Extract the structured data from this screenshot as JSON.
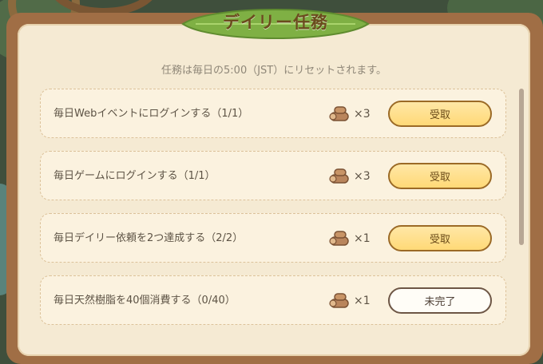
{
  "title": "デイリー任務",
  "notice": "任務は毎日の5:00（JST）にリセットされます。",
  "reward_icon": "wood-log-icon",
  "tasks": [
    {
      "label": "毎日Webイベントにログインする（1/1）",
      "reward": "×3",
      "button": "受取",
      "state": "claim"
    },
    {
      "label": "毎日ゲームにログインする（1/1）",
      "reward": "×3",
      "button": "受取",
      "state": "claim"
    },
    {
      "label": "毎日デイリー依頼を2つ達成する（2/2）",
      "reward": "×1",
      "button": "受取",
      "state": "claim"
    },
    {
      "label": "毎日天然樹脂を40個消費する（0/40）",
      "reward": "×1",
      "button": "未完了",
      "state": "incomplete"
    }
  ],
  "colors": {
    "claim_button": "#ffd977",
    "incomplete_button": "#fffdf7",
    "panel": "#f5ead3",
    "frame": "#a06e45",
    "title_leaf": "#8dbd4e"
  }
}
